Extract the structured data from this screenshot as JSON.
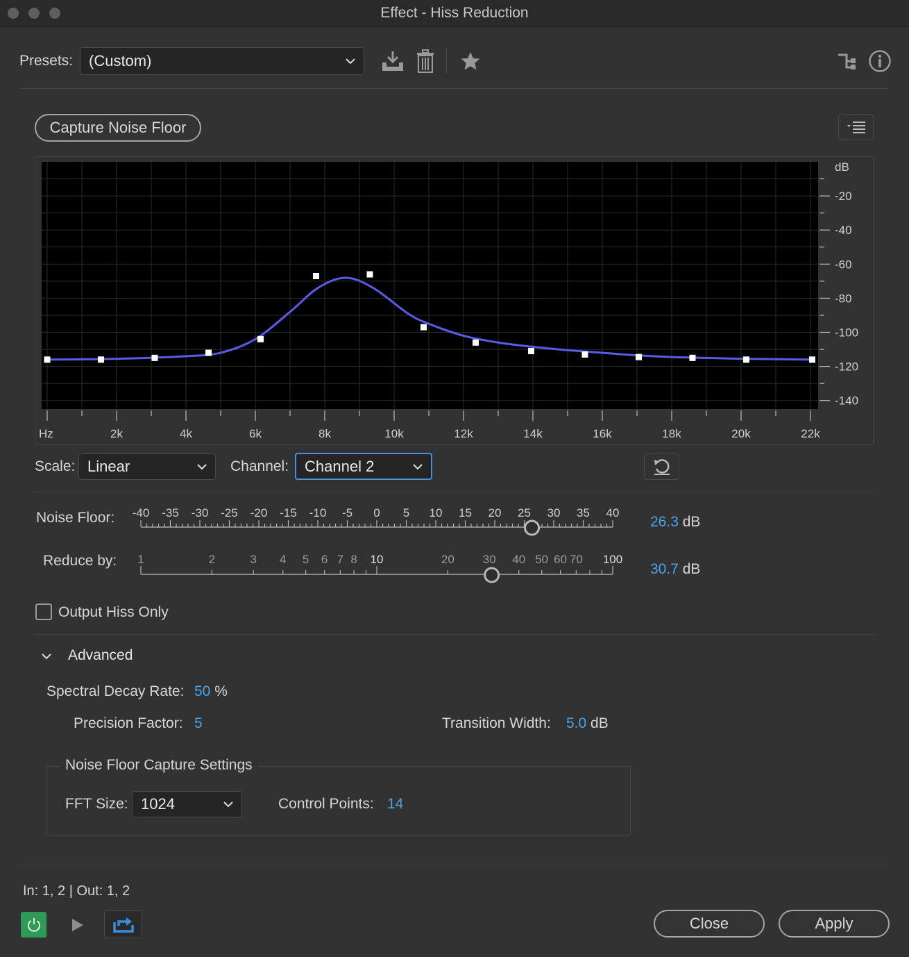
{
  "window": {
    "title": "Effect - Hiss Reduction"
  },
  "presets": {
    "label": "Presets:",
    "value": "(Custom)"
  },
  "capture_button": "Capture Noise Floor",
  "graph": {
    "y_unit": "dB",
    "y_ticks": [
      "-20",
      "-40",
      "-60",
      "-80",
      "-100",
      "-120",
      "-140"
    ],
    "x_ticks": [
      "Hz",
      "2k",
      "4k",
      "6k",
      "8k",
      "10k",
      "12k",
      "14k",
      "16k",
      "18k",
      "20k",
      "22k"
    ]
  },
  "chart_data": {
    "type": "line",
    "xlabel": "",
    "ylabel": "",
    "x_unit": "Hz",
    "y_unit": "dB",
    "xlim": [
      0,
      22000
    ],
    "ylim": [
      -145,
      0
    ],
    "grid": true,
    "series": [
      {
        "x": [
          0,
          2000,
          4000,
          5000,
          6000,
          7000,
          7800,
          8600,
          9400,
          10400,
          11000,
          12000,
          13000,
          14000,
          15000,
          16000,
          17000,
          18000,
          19000,
          20000,
          22000
        ],
        "values": [
          -116,
          -115.5,
          -114,
          -112,
          -104,
          -88,
          -74,
          -68,
          -74,
          -89,
          -95,
          -102,
          -106,
          -108.5,
          -110.5,
          -112,
          -113.5,
          -114.5,
          -115,
          -115.5,
          -116
        ]
      }
    ],
    "control_points": {
      "x": [
        0,
        1550,
        3100,
        4650,
        6150,
        7750,
        9300,
        10850,
        12350,
        13950,
        15500,
        17050,
        18600,
        20150,
        22050
      ],
      "values": [
        -116,
        -116,
        -115,
        -112,
        -104,
        -67,
        -66,
        -97,
        -106,
        -111,
        -113,
        -114.5,
        -115,
        -116,
        -116
      ]
    }
  },
  "scale": {
    "label": "Scale:",
    "value": "Linear"
  },
  "channel": {
    "label": "Channel:",
    "value": "Channel 2"
  },
  "noise_floor": {
    "label": "Noise Floor:",
    "ticks": [
      "-40",
      "-35",
      "-30",
      "-25",
      "-20",
      "-15",
      "-10",
      "-5",
      "0",
      "5",
      "10",
      "15",
      "20",
      "25",
      "30",
      "35",
      "40"
    ],
    "value": "26.3",
    "unit": "dB"
  },
  "reduce_by": {
    "label": "Reduce by:",
    "ticks": [
      "1",
      "2",
      "3",
      "4",
      "5",
      "6",
      "7",
      "8",
      "10",
      "20",
      "30",
      "40",
      "50",
      "60",
      "70",
      "100"
    ],
    "value": "30.7",
    "unit": "dB"
  },
  "output_hiss_only": {
    "label": "Output Hiss Only",
    "checked": false
  },
  "advanced": {
    "label": "Advanced",
    "spectral_decay_label": "Spectral Decay Rate:",
    "spectral_decay_value": "50",
    "spectral_decay_unit": "%",
    "precision_label": "Precision Factor:",
    "precision_value": "5",
    "transition_label": "Transition Width:",
    "transition_value": "5.0",
    "transition_unit": "dB"
  },
  "capture_settings": {
    "title": "Noise Floor Capture Settings",
    "fft_label": "FFT Size:",
    "fft_value": "1024",
    "control_points_label": "Control Points:",
    "control_points_value": "14"
  },
  "io": "In: 1, 2 | Out: 1, 2",
  "buttons": {
    "close": "Close",
    "apply": "Apply"
  }
}
